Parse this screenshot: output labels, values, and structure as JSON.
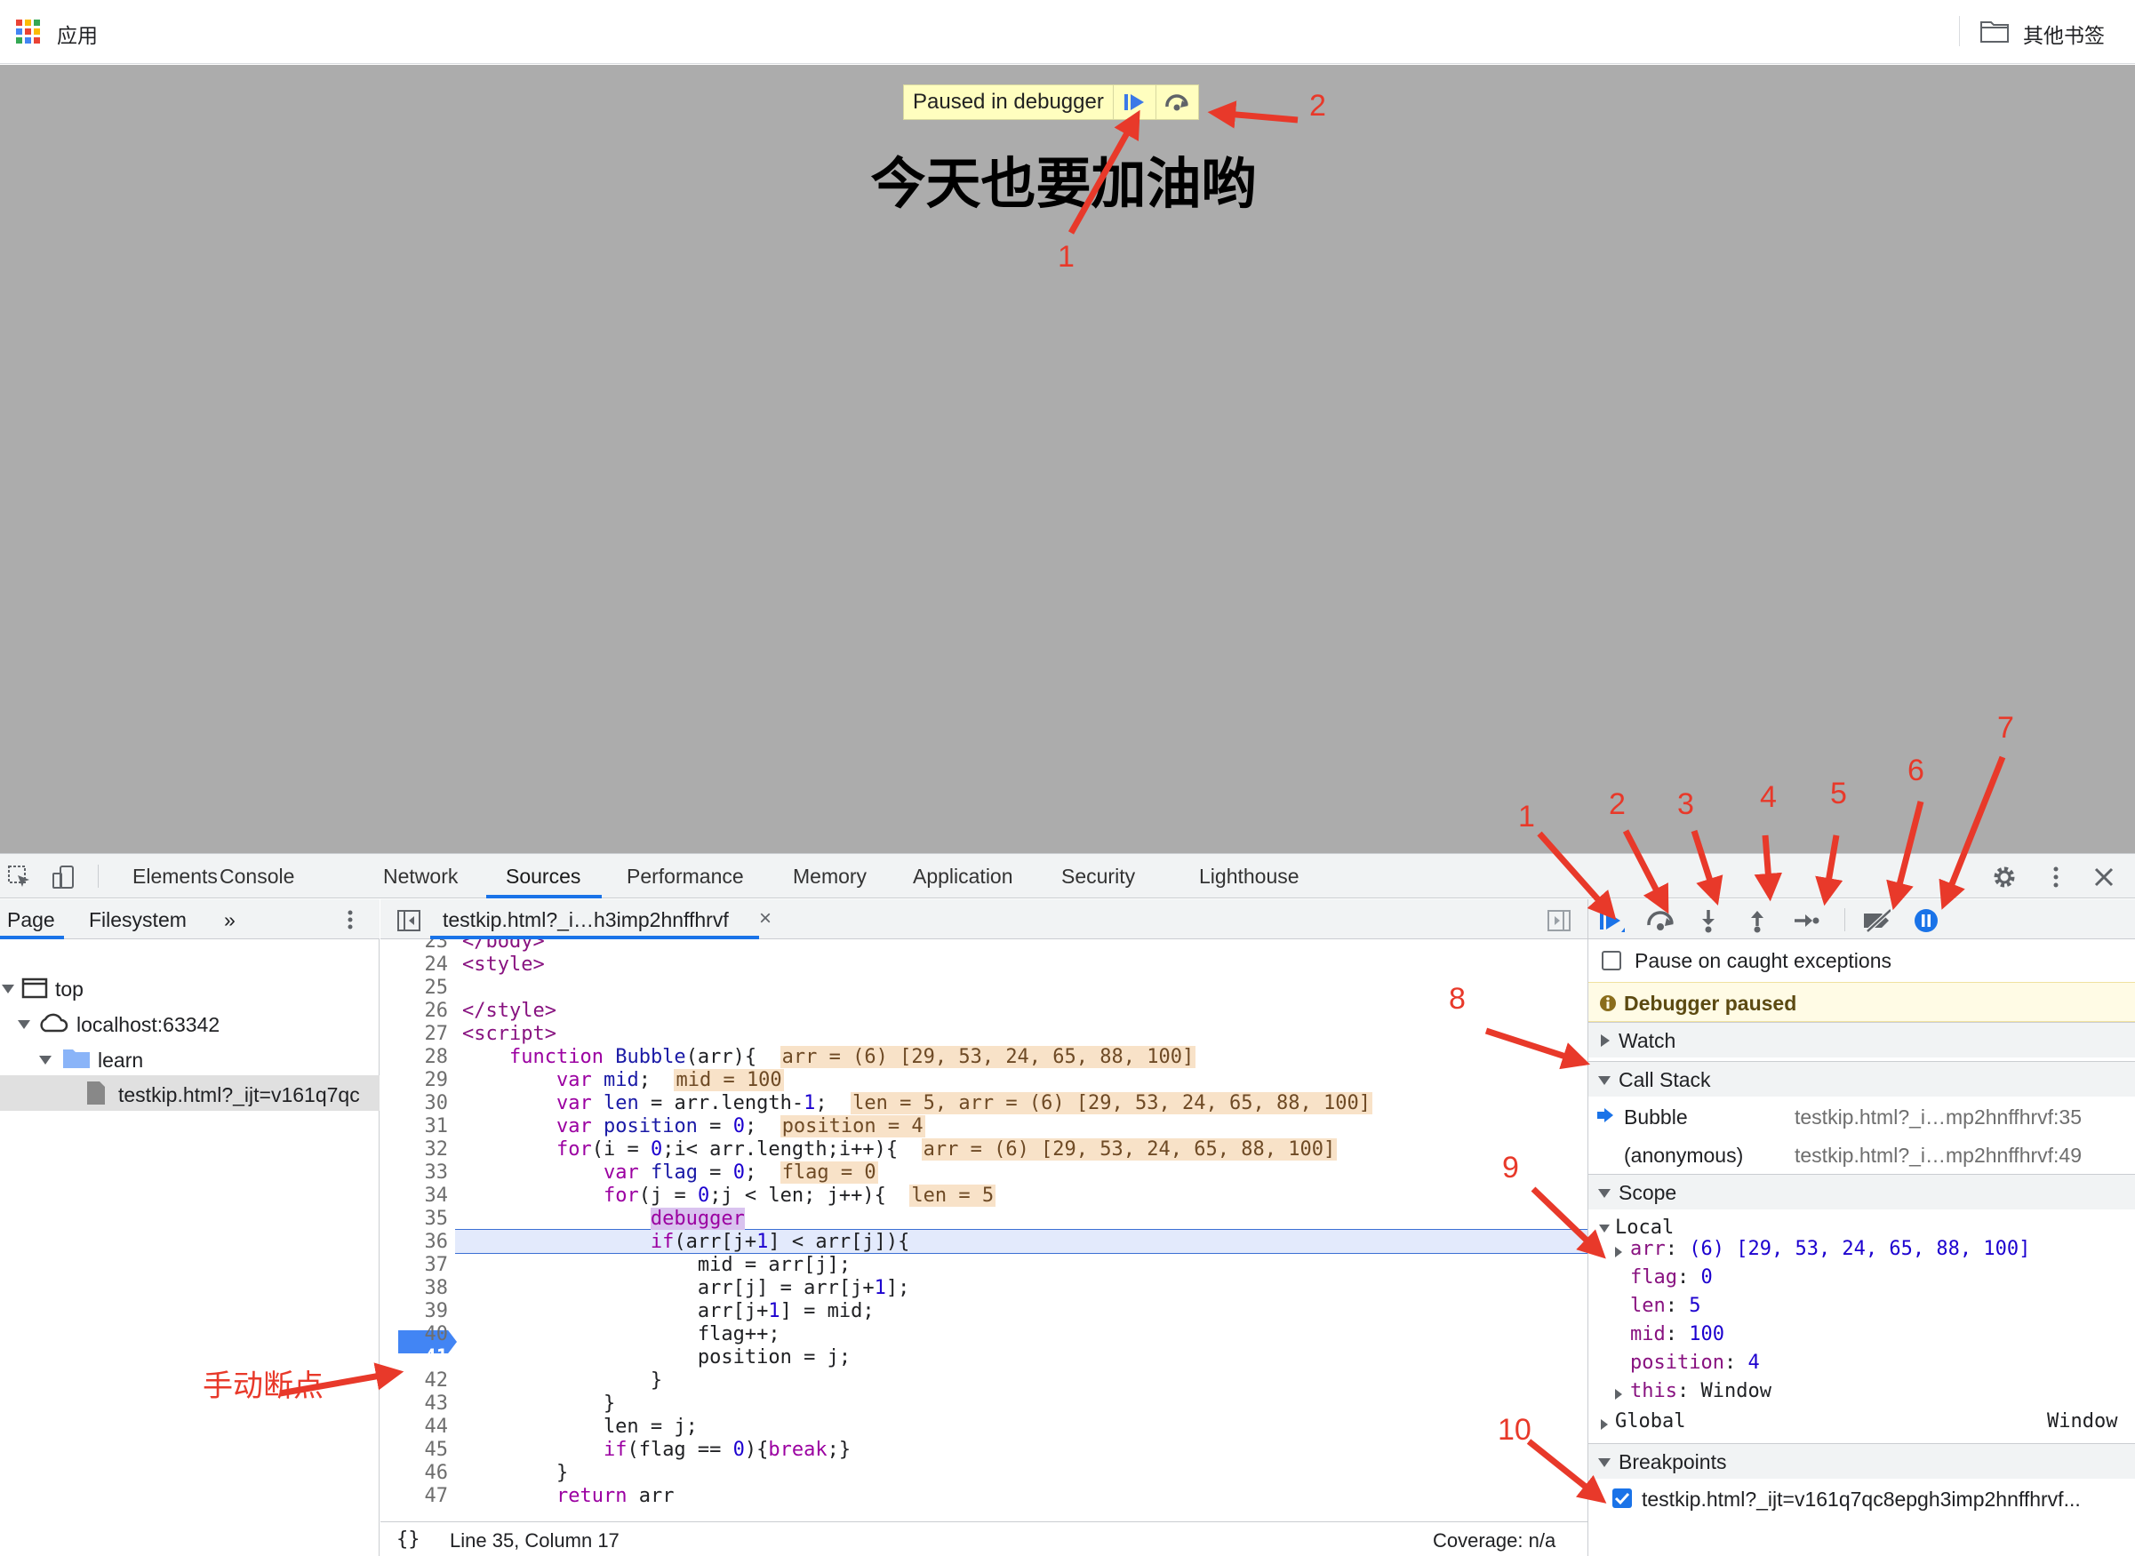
{
  "bookmarks": {
    "apps_label": "应用",
    "other_label": "其他书签"
  },
  "page": {
    "paused_text": "Paused in debugger",
    "heading": "今天也要加油哟"
  },
  "devtools": {
    "tabs": [
      "Elements",
      "Console",
      "Network",
      "Sources",
      "Performance",
      "Memory",
      "Application",
      "Security",
      "Lighthouse"
    ],
    "active_tab": "Sources",
    "navigator": {
      "subtabs": [
        "Page",
        "Filesystem"
      ],
      "more": "»",
      "tree": [
        "top",
        "localhost:63342",
        "learn",
        "testkip.html?_ijt=v161q7qc"
      ]
    },
    "editor": {
      "file_tab": "testkip.html?_i…h3imp2hnffhrvf",
      "close": "×",
      "status_left": "Line 35, Column 17",
      "status_right": "Coverage: n/a",
      "format_icon": "{}"
    },
    "debugger": {
      "pause_caught": "Pause on caught exceptions",
      "paused_banner": "Debugger paused",
      "watch": "Watch",
      "call_stack": "Call Stack",
      "frames": [
        {
          "name": "Bubble",
          "loc": "testkip.html?_i…mp2hnffhrvf:35"
        },
        {
          "name": "(anonymous)",
          "loc": "testkip.html?_i…mp2hnffhrvf:49"
        }
      ],
      "scope": "Scope",
      "local": "Local",
      "scope_vars": [
        {
          "name": "arr",
          "value": "(6) [29, 53, 24, 65, 88, 100]"
        },
        {
          "name": "flag",
          "value": "0"
        },
        {
          "name": "len",
          "value": "5"
        },
        {
          "name": "mid",
          "value": "100"
        },
        {
          "name": "position",
          "value": "4"
        },
        {
          "name": "this",
          "value": "Window"
        }
      ],
      "global": "Global",
      "global_value": "Window",
      "breakpoints": "Breakpoints",
      "breakpoint_item": "testkip.html?_ijt=v161q7qc8epgh3imp2hnffhrvf..."
    }
  },
  "annotations": {
    "page_nums": [
      "1",
      "2"
    ],
    "toolbar_nums": [
      "1",
      "2",
      "3",
      "4",
      "5",
      "6",
      "7",
      "8",
      "9",
      "10"
    ],
    "manual_breakpoint": "手动断点"
  },
  "colors": {
    "annotation": "#e8392a",
    "accent": "#1a73e8",
    "breakpoint": "#4285f4"
  }
}
